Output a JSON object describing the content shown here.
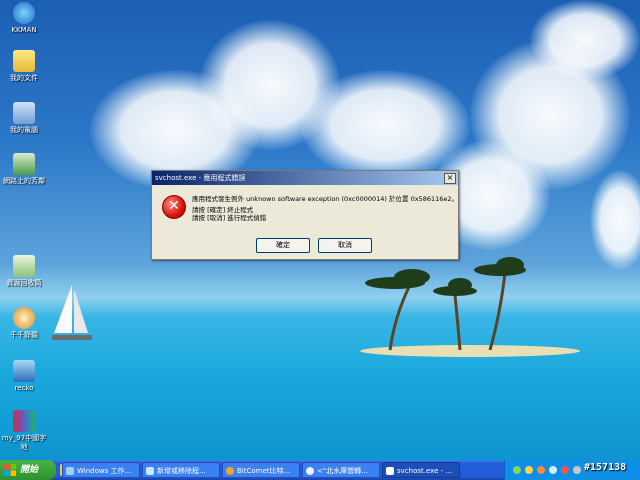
{
  "desktop_icons": [
    {
      "label": "KKMAN",
      "icon": "kkman-icon"
    },
    {
      "label": "我的文件",
      "icon": "my-documents-icon"
    },
    {
      "label": "我的電腦",
      "icon": "my-computer-icon"
    },
    {
      "label": "網路上的芳鄰",
      "icon": "network-places-icon"
    },
    {
      "label": "資源回收筒",
      "icon": "recycle-bin-icon"
    },
    {
      "label": "千千靜聽",
      "icon": "music-player-icon"
    },
    {
      "label": "recko",
      "icon": "app-icon"
    },
    {
      "label": "my_97中國字",
      "icon": "archive-icon"
    },
    {
      "label": "地",
      "icon": ""
    }
  ],
  "dialog": {
    "title": "svchost.exe - 應用程式錯誤",
    "close_glyph": "×",
    "error_glyph": "✕",
    "message_line1": "應用程式發生例外 unknown software exception (0xc0000014) 於位置 0x586116e2。",
    "message_line2": "請按 [確定] 終止程式",
    "message_line3": "請按 [取消] 進行程式偵錯",
    "ok_label": "確定",
    "cancel_label": "取消"
  },
  "taskbar": {
    "start_label": "開始",
    "tasks": [
      {
        "label": "Windows 工作...",
        "active": false
      },
      {
        "label": "新增或移除程...",
        "active": false
      },
      {
        "label": "BitComet比特...",
        "active": false
      },
      {
        "label": "<\"北水庫營轉...",
        "active": false
      },
      {
        "label": "svchost.exe - ...",
        "active": true
      }
    ]
  },
  "watermark": "#157138",
  "colors": {
    "title_bar": "#0a246a",
    "taskbar": "#245edb",
    "start": "#3a9c3a",
    "error": "#d8140c"
  }
}
